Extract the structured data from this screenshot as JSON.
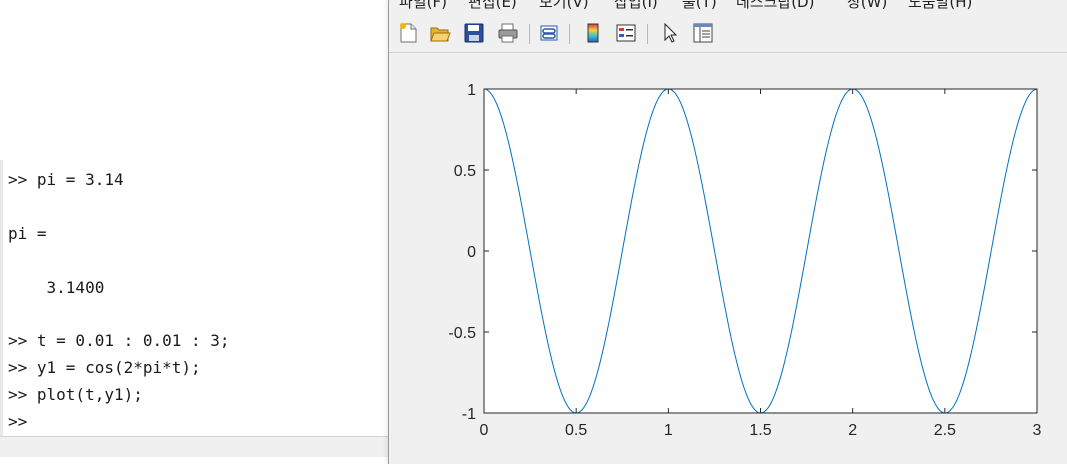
{
  "command_window": {
    "lines": [
      ">> pi = 3.14",
      "pi =",
      "    3.1400",
      ">> t = 0.01 : 0.01 : 3;",
      ">> y1 = cos(2*pi*t);",
      ">> plot(t,y1);",
      ">>"
    ]
  },
  "figure_window": {
    "menu": {
      "file": "파일(F)",
      "edit": "편집(E)",
      "view": "보기(V)",
      "insert": "삽입(I)",
      "tools": "툴(T)",
      "desktop": "데스크탑(D)",
      "window": "창(W)",
      "help": "도움말(H)"
    },
    "toolbar": [
      "new-figure-icon",
      "open-file-icon",
      "save-icon",
      "print-icon",
      "link-plot-icon",
      "insert-colorbar-icon",
      "insert-legend-icon",
      "edit-plot-arrow-icon",
      "property-editor-icon"
    ]
  },
  "chart_data": {
    "type": "line",
    "title": "",
    "xlabel": "",
    "ylabel": "",
    "xlim": [
      0,
      3
    ],
    "ylim": [
      -1,
      1
    ],
    "xticks": [
      "0",
      "0.5",
      "1",
      "1.5",
      "2",
      "2.5",
      "3"
    ],
    "yticks": [
      "1",
      "0.5",
      "0",
      "-0.5",
      "-1"
    ],
    "grid": false,
    "color": "#0072bd",
    "series": [
      {
        "expression": "cos(2*pi*t)",
        "pi_value": 3.14,
        "x_start": 0.01,
        "x_step": 0.01,
        "x_end": 3
      }
    ]
  }
}
